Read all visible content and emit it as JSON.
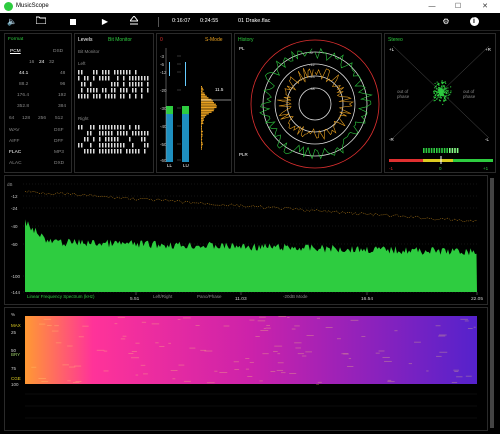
{
  "window": {
    "title": "MusicScope",
    "minimize": "—",
    "maximize": "☐",
    "close": "✕"
  },
  "toolbar": {
    "speaker_icon": "speaker-icon",
    "folder_icon": "folder-icon",
    "stop_icon": "stop-icon",
    "play_icon": "play-icon",
    "eject_icon": "eject-icon",
    "position": "0:16:07",
    "duration": "0:24:55",
    "track": "01 Drake.flac",
    "settings_icon": "gear-icon",
    "info_icon": "info-icon"
  },
  "format": {
    "title": "Format",
    "pcm": "PCM",
    "dsd": "DSD",
    "bits": [
      "16",
      "24",
      "32"
    ],
    "rows": [
      [
        "44.1",
        "48"
      ],
      [
        "88.2",
        "96"
      ],
      [
        "176.4",
        "192"
      ],
      [
        "352.8",
        "384"
      ]
    ],
    "dsd_rates": [
      "64",
      "128",
      "256",
      "512"
    ],
    "codecs": [
      [
        "WAV",
        "DSF"
      ],
      [
        "AIFF",
        "DFF"
      ],
      [
        "FLAC",
        "MP3"
      ],
      [
        "ALAC",
        "DXD"
      ]
    ]
  },
  "levels": {
    "title": "Levels",
    "bit_monitor": "Bit Monitor",
    "bit_monitor2": "Bit Monitor",
    "left": "Left",
    "right": "Right"
  },
  "meters": {
    "scale_top": "0",
    "s_mode": "S-Mode",
    "ticks": [
      "-3",
      "-6",
      "-12",
      "-20",
      "-30",
      "-40",
      "-50",
      "-60"
    ],
    "peak_value": "11.5",
    "ch_labels": [
      "LL",
      "LU"
    ]
  },
  "history": {
    "title": "History",
    "pl": "PL",
    "plr": "PLR",
    "rings": [
      "-6",
      "-12",
      "-24",
      "-48"
    ]
  },
  "stereo": {
    "title": "Stereo",
    "plus_l": "+L",
    "plus_r": "+R",
    "minus_l": "-R",
    "minus_r": "-L",
    "out_phase_left": "out of phase",
    "out_phase_right": "out of phase",
    "corr_min": "-1",
    "corr_mid": "0",
    "corr_max": "+1"
  },
  "spectrum": {
    "db_unit": "dB",
    "y_ticks": [
      "0",
      "-12",
      "-24",
      "-40",
      "-60",
      "-100",
      "-144"
    ],
    "x_ticks": [
      "5.51",
      "11.03",
      "16.54",
      "22.05"
    ],
    "caption": "Linear Frequency Spectrum (kHz)",
    "modes": [
      "Left/Right",
      "Pano/Phase",
      "-20dB Mode"
    ]
  },
  "spectrogram": {
    "y_ticks": [
      "%",
      "25",
      "50",
      "75",
      "100"
    ],
    "side_labels": [
      "MAX",
      "BRY",
      "CGE"
    ]
  },
  "colors": {
    "green": "#2ecc40",
    "orange": "#e8a020",
    "red": "#e03030",
    "blue": "#1e8fc0"
  }
}
